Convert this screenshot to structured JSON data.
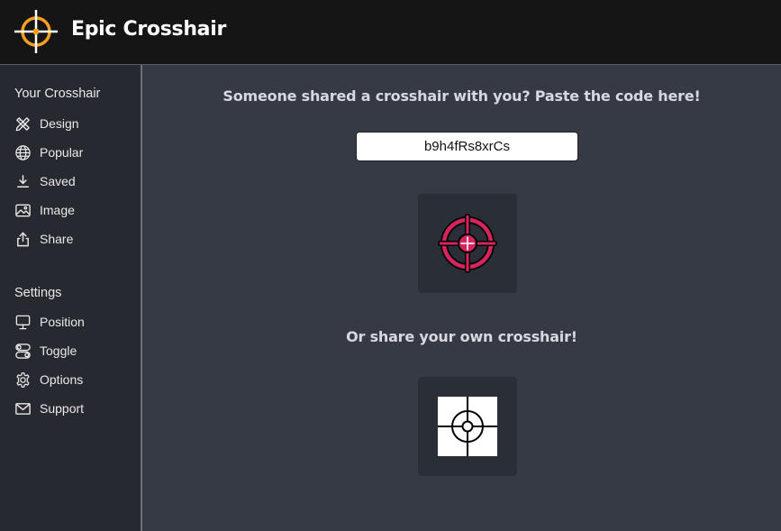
{
  "app": {
    "title": "Epic Crosshair"
  },
  "colors": {
    "accent": "#f5a021",
    "crosshair_fill": "#d6245e",
    "topbar_bg": "#151515",
    "sidebar_bg": "#262930",
    "main_bg": "#353a45"
  },
  "sidebar": {
    "section_crosshair": "Your Crosshair",
    "crosshair_items": [
      {
        "label": "Design",
        "icon": "pencil-ruler-icon"
      },
      {
        "label": "Popular",
        "icon": "globe-icon"
      },
      {
        "label": "Saved",
        "icon": "download-icon"
      },
      {
        "label": "Image",
        "icon": "image-icon"
      },
      {
        "label": "Share",
        "icon": "share-icon"
      }
    ],
    "section_settings": "Settings",
    "settings_items": [
      {
        "label": "Position",
        "icon": "monitor-icon"
      },
      {
        "label": "Toggle",
        "icon": "toggle-icon"
      },
      {
        "label": "Options",
        "icon": "gear-icon"
      },
      {
        "label": "Support",
        "icon": "mail-icon"
      }
    ]
  },
  "main": {
    "paste_heading": "Someone shared a crosshair with you? Paste the code here!",
    "code_value": "b9h4fRs8xrCs",
    "share_heading": "Or share your own crosshair!"
  }
}
